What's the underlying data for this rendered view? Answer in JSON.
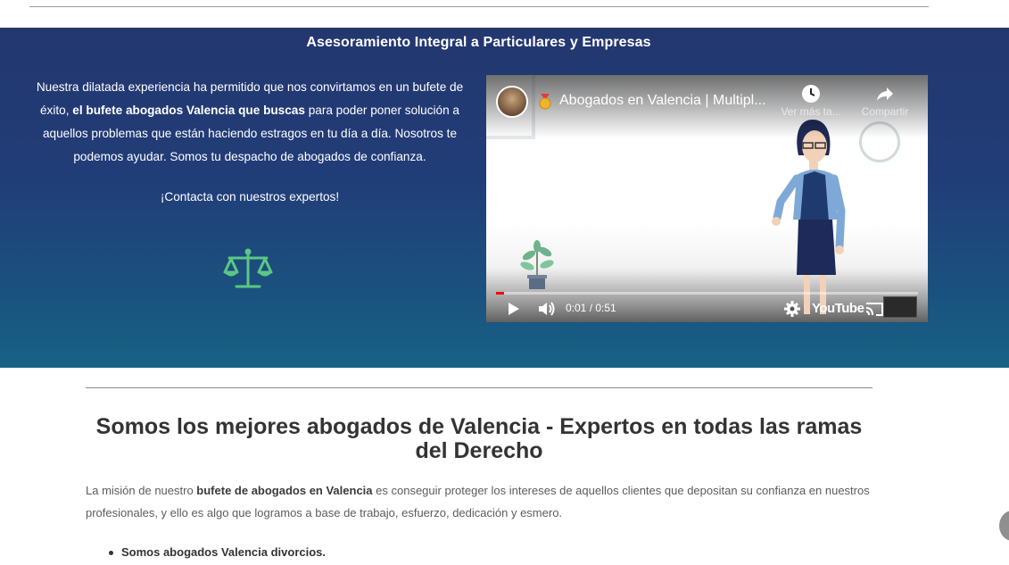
{
  "hero": {
    "title": "Asesoramiento Integral a Particulares y Empresas",
    "text_part1": "Nuestra dilatada experiencia ha permitido que nos convirtamos en un bufete de éxito, ",
    "text_bold": "el bufete abogados Valencia que buscas",
    "text_part2": " para poder poner solución a aquellos problemas que están haciendo estragos en tu día a día. Nosotros te podemos ayudar. Somos tu despacho de abogados de confianza.",
    "cta": "¡Contacta con nuestros expertos!",
    "icon": "scales-of-justice-icon",
    "icon_color": "#5cc783"
  },
  "video": {
    "title": "Abogados en Valencia | Multipl...",
    "watch_later": "Ver más ta...",
    "share": "Compartir",
    "time": "0:01 / 0:51",
    "progress": 0.02,
    "brand": "YouTube",
    "accent": "#ff0000"
  },
  "section": {
    "title": "Somos los mejores abogados de Valencia - Expertos en todas las ramas del Derecho",
    "text_part1": "La misión de nuestro ",
    "text_bold": "bufete de abogados en Valencia",
    "text_part2": " es conseguir proteger los intereses de aquellos clientes que depositan su confianza en nuestros profesionales, y ello es algo que logramos a base de trabajo, esfuerzo, dedicación y esmero.",
    "bullets": [
      "Somos abogados Valencia divorcios."
    ]
  }
}
